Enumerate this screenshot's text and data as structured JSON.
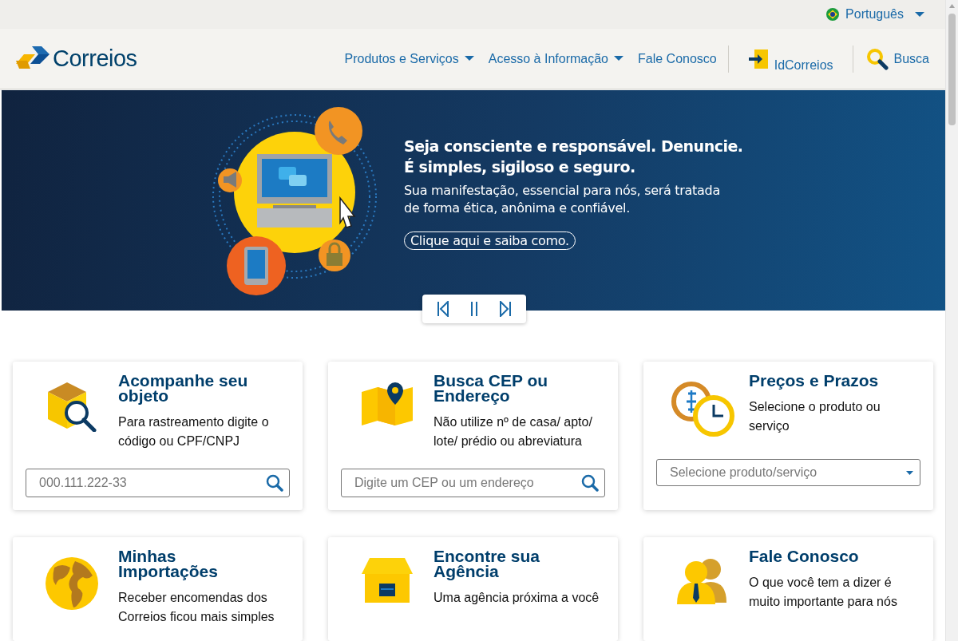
{
  "language": {
    "label": "Português"
  },
  "header": {
    "logo_text": "Correios",
    "nav": [
      {
        "label": "Produtos e Serviços",
        "dropdown": true
      },
      {
        "label": "Acesso à Informação",
        "dropdown": true
      },
      {
        "label": "Fale Conosco",
        "dropdown": false
      }
    ],
    "login": "IdCorreios",
    "search": "Busca"
  },
  "banner": {
    "headline": [
      "Seja consciente e responsável. Denuncie.",
      "É simples, sigiloso e seguro."
    ],
    "body": "Sua manifestação, essencial para nós, será tratada de forma ética, anônima e confiável.",
    "link": "Clique aqui e saiba como."
  },
  "cards": [
    {
      "title": "Acompanhe seu objeto",
      "text": "Para rastreamento digite o código ou CPF/CNPJ",
      "kind": "search",
      "placeholder": "000.111.222-33"
    },
    {
      "title": "Busca CEP ou Endereço",
      "text": "Não utilize nº de casa/ apto/ lote/ prédio ou abreviatura",
      "kind": "search",
      "placeholder": "Digite um CEP ou um endereço"
    },
    {
      "title": "Preços e Prazos",
      "text": "Selecione o produto ou serviço",
      "kind": "select",
      "placeholder": "Selecione produto/serviço"
    },
    {
      "title": "Minhas Importações",
      "text": "Receber encomendas dos Correios ficou mais simples",
      "kind": "info"
    },
    {
      "title": "Encontre sua Agência",
      "text": "Uma agência próxima a você",
      "kind": "info"
    },
    {
      "title": "Fale Conosco",
      "text": "O que você tem a dizer é muito importante para nós",
      "kind": "info"
    }
  ]
}
